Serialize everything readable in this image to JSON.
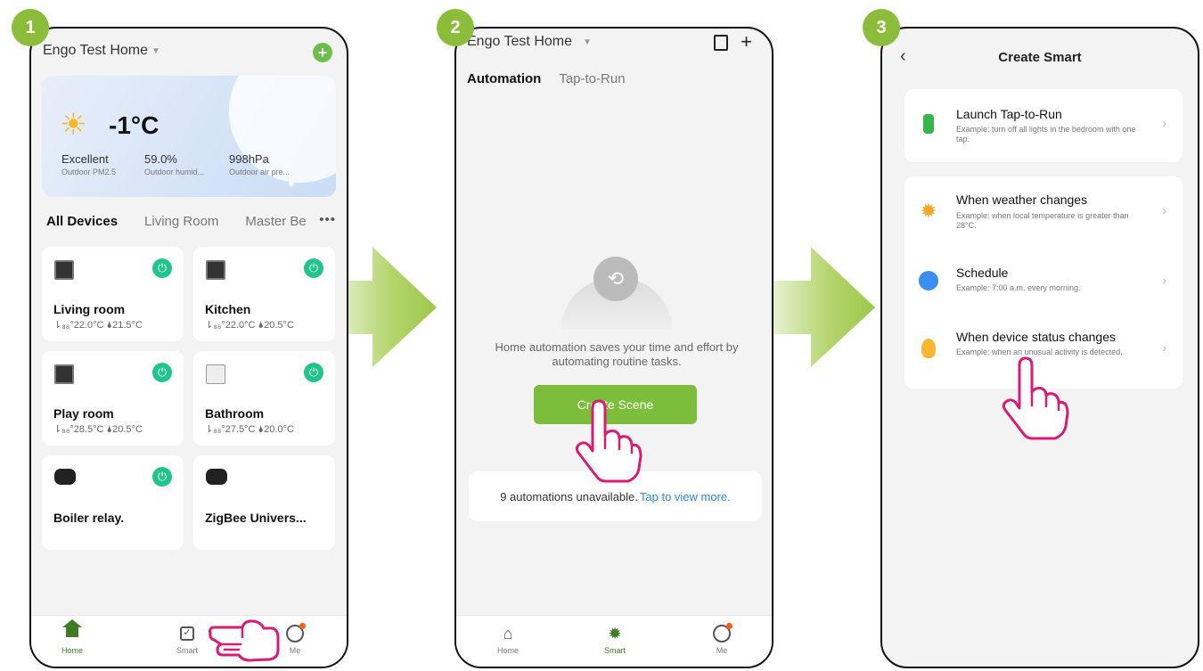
{
  "steps": [
    "1",
    "2",
    "3"
  ],
  "colors": {
    "accent_green": "#7cbd3b",
    "step_badge": "#8bbd3a",
    "hand": "#d81b74",
    "link_blue": "#2a86e8"
  },
  "phone1": {
    "home_name": "Engo Test Home",
    "add_icon": "plus-circle-icon",
    "weather": {
      "temp": "-1°C",
      "stats": [
        {
          "value": "Excellent",
          "label": "Outdoor PM2.5"
        },
        {
          "value": "59.0%",
          "label": "Outdoor humid..."
        },
        {
          "value": "998hPa",
          "label": "Outdoor air pre..."
        }
      ]
    },
    "room_tabs": [
      "All Devices",
      "Living Room",
      "Master Be"
    ],
    "more": "•••",
    "devices": [
      {
        "name": "Living room",
        "sub": "⇂₈₈°22.0°C  🌢21.5°C"
      },
      {
        "name": "Kitchen",
        "sub": "⇂₈₈°22.0°C  🌢20.5°C"
      },
      {
        "name": "Play room",
        "sub": "⇂₈₈°28.5°C  🌢20.5°C"
      },
      {
        "name": "Bathroom",
        "sub": "⇂₈₈°27.5°C  🌢20.0°C"
      },
      {
        "name": "Boiler relay.",
        "sub": ""
      },
      {
        "name": "ZigBee Univers...",
        "sub": ""
      }
    ],
    "tabbar": [
      "Home",
      "Smart",
      "Me"
    ]
  },
  "phone2": {
    "home_name": "Engo Test Home",
    "tabs": [
      "Automation",
      "Tap-to-Run"
    ],
    "empty_text": "Home automation saves your time and effort by automating routine tasks.",
    "create_button": "Create Scene",
    "unavailable": "9 automations unavailable.",
    "unavailable_link": "Tap to view more.",
    "tabbar": [
      "Home",
      "Smart",
      "Me"
    ]
  },
  "phone3": {
    "title": "Create Smart",
    "items": [
      {
        "title": "Launch Tap-to-Run",
        "desc": "Example: turn off all lights in the bedroom with one tap."
      },
      {
        "title": "When weather changes",
        "desc": "Example: when local temperature is greater than 28°C."
      },
      {
        "title": "Schedule",
        "desc": "Example: 7:00 a.m. every morning."
      },
      {
        "title": "When device status changes",
        "desc": "Example: when an unusual activity is detected."
      }
    ]
  }
}
